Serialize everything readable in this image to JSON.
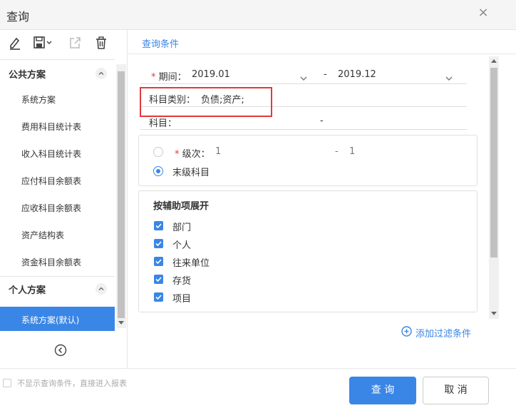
{
  "dialog": {
    "title": "查询",
    "close_symbol": "×"
  },
  "toolbar": {
    "icons": [
      "edit-icon",
      "save-icon",
      "export-icon",
      "delete-icon"
    ]
  },
  "sidebar": {
    "public_group": "公共方案",
    "public_items": [
      "系统方案",
      "费用科目统计表",
      "收入科目统计表",
      "应付科目余额表",
      "应收科目余额表",
      "资产结构表",
      "资金科目余额表"
    ],
    "personal_group": "个人方案",
    "personal_items": [
      "系统方案(默认)"
    ]
  },
  "tabs": {
    "active": "查询条件"
  },
  "form": {
    "period_required": "*",
    "period_label": "期间：",
    "period_from": "2019.01",
    "period_dash": "-",
    "period_to": "2019.12",
    "category_label": "科目类别：",
    "category_value": "负债;资产;",
    "subject_label": "科目：",
    "subject_dash": "-",
    "level_required": "*",
    "level_label": "级次：",
    "level_from": "1",
    "level_dash": "-",
    "level_to": "1",
    "last_level_label": "末级科目",
    "aux_title": "按辅助项展开",
    "aux_items": [
      "部门",
      "个人",
      "往来单位",
      "存货",
      "项目"
    ],
    "add_filter": "添加过滤条件"
  },
  "footer": {
    "skip_text": "不显示查询条件，直接进入报表",
    "query_button": "查 询",
    "cancel_button": "取 消"
  },
  "colors": {
    "accent": "#3a86e6",
    "highlight": "#e4393c"
  }
}
